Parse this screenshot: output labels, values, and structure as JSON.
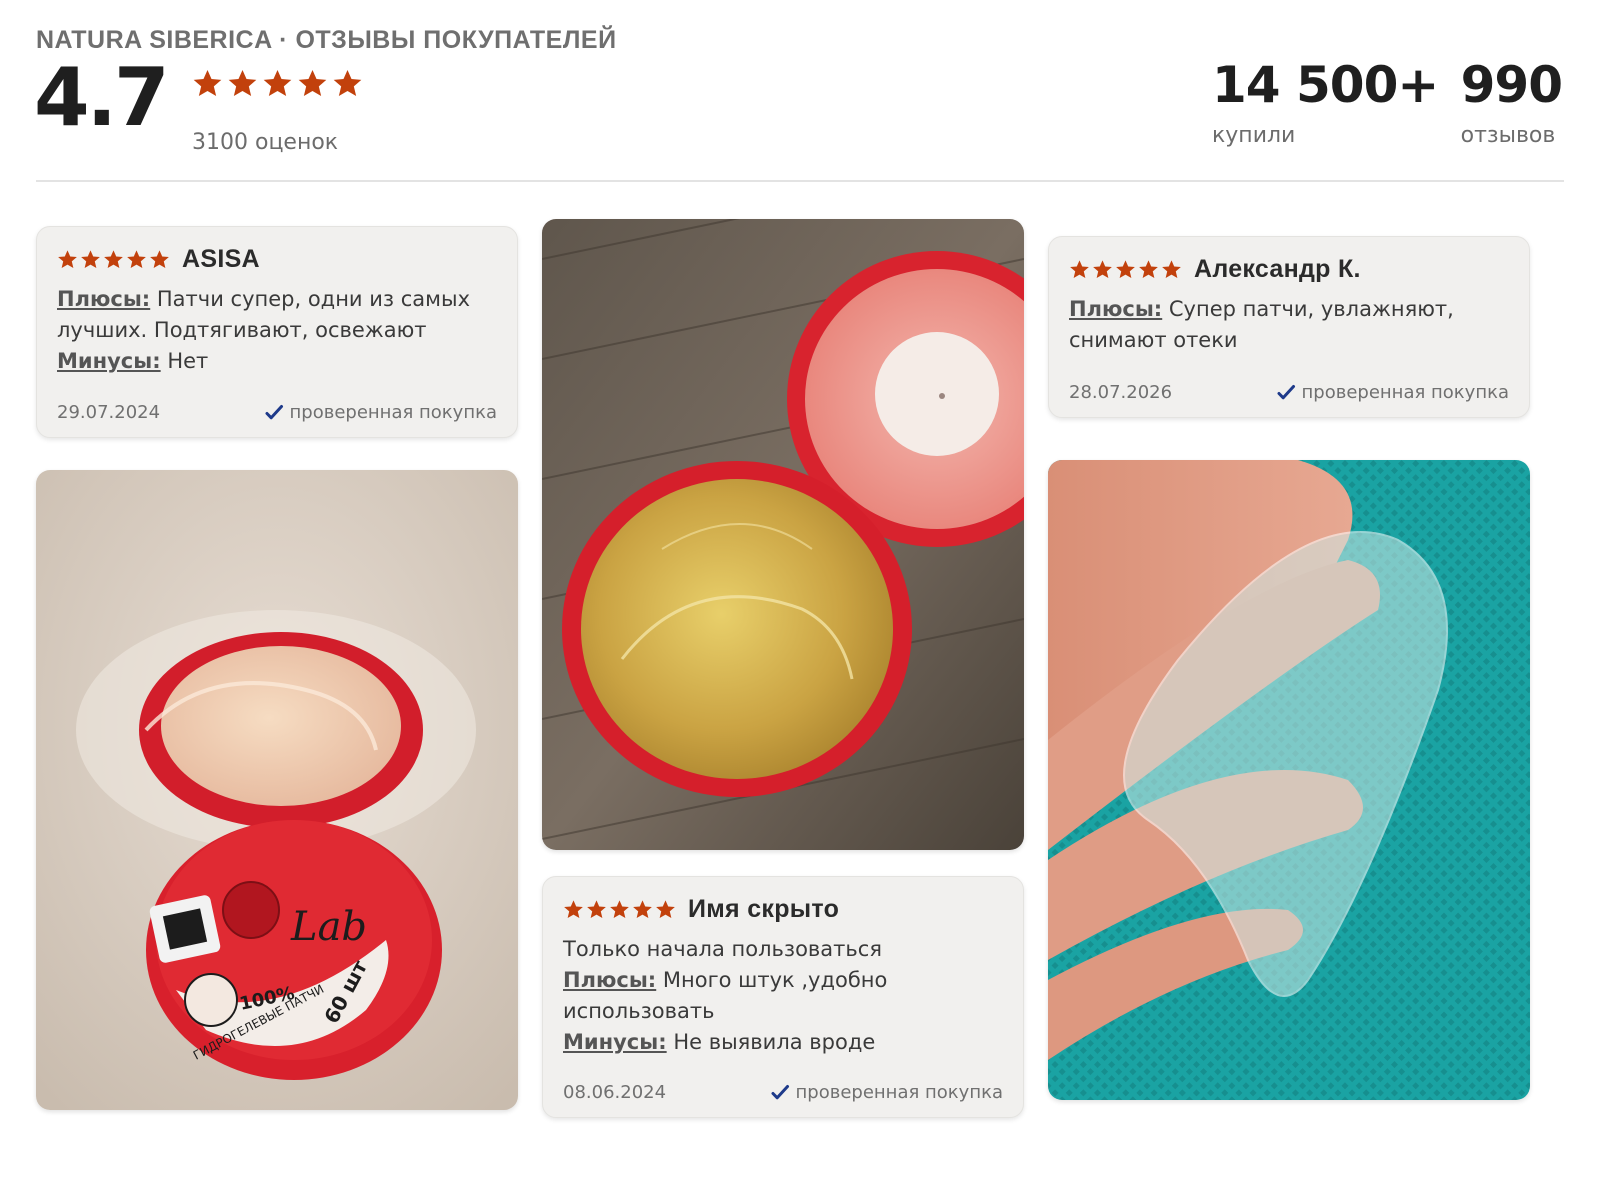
{
  "header": {
    "brand": "NATURA SIBERICA · ОТЗЫВЫ ПОКУПАТЕЛЕЙ",
    "rating": "4.7",
    "stars": 5,
    "ratings_count": "3100 оценок",
    "bought_value": "14 500+",
    "bought_label": "купили",
    "reviews_value": "990",
    "reviews_label": "отзывов"
  },
  "colors": {
    "star": "#c2410c",
    "check": "#1e3a8a",
    "card_bg": "#f1f0ee"
  },
  "reviews": [
    {
      "stars": 5,
      "author": "ASISA",
      "text": "",
      "pros_label": "Плюсы:",
      "pros": " Патчи супер, одни из самых лучших. Подтягивают, освежают",
      "cons_label": "Минусы:",
      "cons": " Нет",
      "date": "29.07.2024",
      "verified": "проверенная покупка"
    },
    {
      "stars": 5,
      "author": "Имя скрыто",
      "text": "Только начала пользоваться",
      "pros_label": "Плюсы:",
      "pros": " Много штук ,удобно использовать",
      "cons_label": "Минусы:",
      "cons": " Не выявила вроде",
      "date": "08.06.2024",
      "verified": "проверенная покупка"
    },
    {
      "stars": 5,
      "author": "Александр К.",
      "text": "",
      "pros_label": "Плюсы:",
      "pros": " Супер патчи, увлажняют, снимают отеки",
      "date": "28.07.2026",
      "verified": "проверенная покупка"
    }
  ],
  "photos": {
    "jar_lid_text_1": "100%",
    "jar_lid_text_2": "ГИДРОГЕЛЕВЫЕ ПАТЧИ",
    "jar_lid_text_3": "60 шт",
    "jar_logo": "Lab"
  }
}
